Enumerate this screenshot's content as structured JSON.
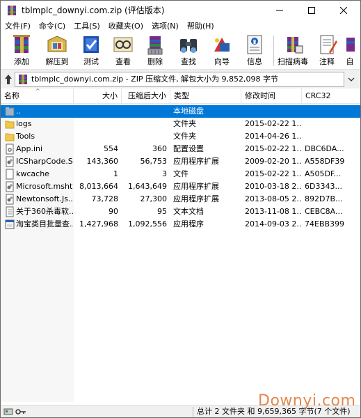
{
  "window": {
    "title": "tblmplc_downyi.com.zip (评估版本)",
    "controls": {
      "minimize": "—",
      "maximize": "☐",
      "close": "✕"
    }
  },
  "menu": [
    "文件(F)",
    "命令(C)",
    "工具(S)",
    "收藏夹(O)",
    "选项(N)",
    "帮助(H)"
  ],
  "toolbar": {
    "buttons": [
      {
        "label": "添加",
        "icon": "add-archive-icon"
      },
      {
        "label": "解压到",
        "icon": "extract-to-icon"
      },
      {
        "label": "测试",
        "icon": "test-icon"
      },
      {
        "label": "查看",
        "icon": "view-icon"
      },
      {
        "label": "删除",
        "icon": "delete-icon"
      },
      {
        "label": "查找",
        "icon": "find-icon"
      },
      {
        "label": "向导",
        "icon": "wizard-icon"
      },
      {
        "label": "信息",
        "icon": "info-icon"
      },
      {
        "label": "扫描病毒",
        "icon": "virus-scan-icon"
      },
      {
        "label": "注释",
        "icon": "comment-icon"
      },
      {
        "label": "自",
        "icon": "sfx-icon"
      }
    ]
  },
  "address": {
    "text": "tblmplc_downyi.com.zip - ZIP 压缩文件, 解包大小为 9,852,098 字节"
  },
  "columns": {
    "name": "名称",
    "size": "大小",
    "packed": "压缩后大小",
    "type": "类型",
    "modified": "修改时间",
    "crc": "CRC32"
  },
  "files": [
    {
      "name": "..",
      "size": "",
      "packed": "",
      "type": "本地磁盘",
      "modified": "",
      "crc": "",
      "icon": "parent-folder-icon",
      "selected": true
    },
    {
      "name": "logs",
      "size": "",
      "packed": "",
      "type": "文件夹",
      "modified": "2015-02-22 1...",
      "crc": "",
      "icon": "folder-icon"
    },
    {
      "name": "Tools",
      "size": "",
      "packed": "",
      "type": "文件夹",
      "modified": "2014-04-26 1...",
      "crc": "",
      "icon": "folder-icon"
    },
    {
      "name": "App.ini",
      "size": "554",
      "packed": "360",
      "type": "配置设置",
      "modified": "2015-02-22 1...",
      "crc": "DBC6DA...",
      "icon": "settings-file-icon"
    },
    {
      "name": "ICSharpCode.S...",
      "size": "143,360",
      "packed": "56,753",
      "type": "应用程序扩展",
      "modified": "2009-02-20 1...",
      "crc": "A558DF39",
      "icon": "dll-file-icon"
    },
    {
      "name": "kwcache",
      "size": "1",
      "packed": "3",
      "type": "文件",
      "modified": "2015-02-22 1...",
      "crc": "A505DF...",
      "icon": "file-icon"
    },
    {
      "name": "Microsoft.msht...",
      "size": "8,013,664",
      "packed": "1,643,649",
      "type": "应用程序扩展",
      "modified": "2010-03-18 2...",
      "crc": "6D3343...",
      "icon": "dll-file-icon"
    },
    {
      "name": "Newtonsoft.Js...",
      "size": "73,728",
      "packed": "27,300",
      "type": "应用程序扩展",
      "modified": "2013-08-05 2...",
      "crc": "892D7B...",
      "icon": "dll-file-icon"
    },
    {
      "name": "关于360杀毒软...",
      "size": "90",
      "packed": "95",
      "type": "文本文档",
      "modified": "2013-11-08 1...",
      "crc": "CEBC8A...",
      "icon": "text-file-icon"
    },
    {
      "name": "淘宝类目批量查...",
      "size": "1,427,968",
      "packed": "1,092,556",
      "type": "应用程序",
      "modified": "2014-09-03 2...",
      "crc": "74EBB399",
      "icon": "exe-file-icon"
    }
  ],
  "status": {
    "text": "总计 2 文件夹 和 9,659,365 字节(7 个文件)"
  },
  "watermark": "Downyi.com"
}
